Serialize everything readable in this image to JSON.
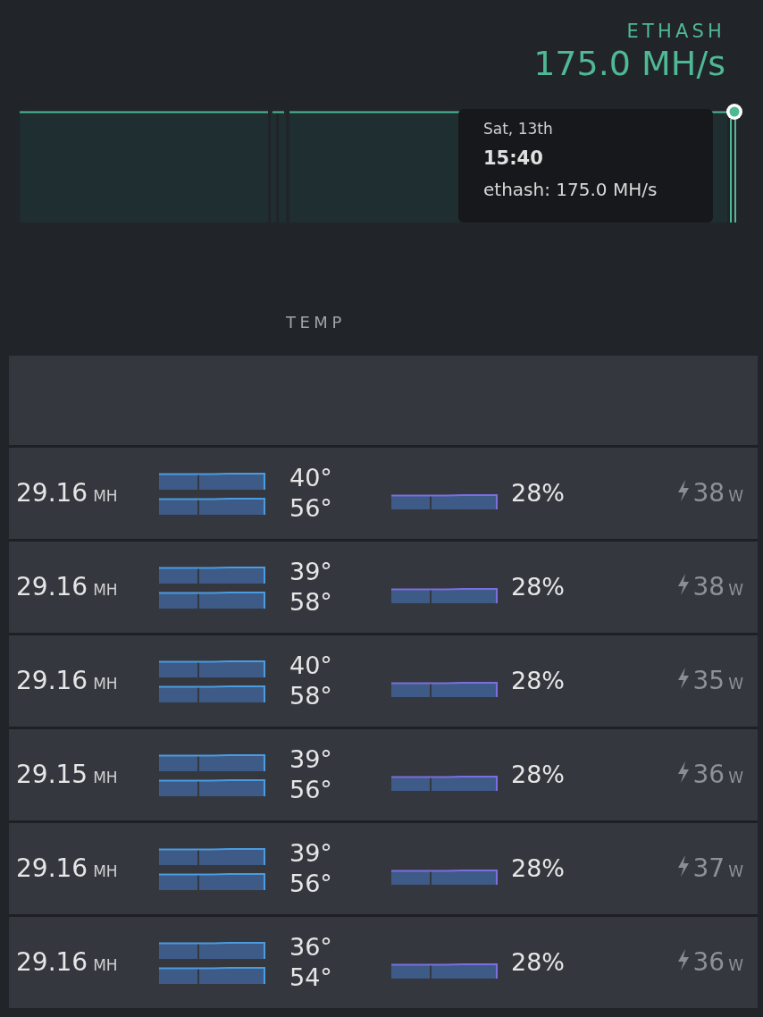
{
  "algorithm": {
    "label": "ETHASH",
    "hashrate": "175.0 MH/s"
  },
  "tooltip": {
    "date": "Sat, 13th",
    "time": "15:40",
    "value": "ethash: 175.0 MH/s"
  },
  "section_label": "TEMP",
  "gpus": [
    {
      "hashrate": "29.16",
      "unit": "MH",
      "temp_core": "40°",
      "temp_mem": "56°",
      "fan": "28%",
      "power": "38",
      "power_unit": "W"
    },
    {
      "hashrate": "29.16",
      "unit": "MH",
      "temp_core": "39°",
      "temp_mem": "58°",
      "fan": "28%",
      "power": "38",
      "power_unit": "W"
    },
    {
      "hashrate": "29.16",
      "unit": "MH",
      "temp_core": "40°",
      "temp_mem": "58°",
      "fan": "28%",
      "power": "35",
      "power_unit": "W"
    },
    {
      "hashrate": "29.15",
      "unit": "MH",
      "temp_core": "39°",
      "temp_mem": "56°",
      "fan": "28%",
      "power": "36",
      "power_unit": "W"
    },
    {
      "hashrate": "29.16",
      "unit": "MH",
      "temp_core": "39°",
      "temp_mem": "56°",
      "fan": "28%",
      "power": "37",
      "power_unit": "W"
    },
    {
      "hashrate": "29.16",
      "unit": "MH",
      "temp_core": "36°",
      "temp_mem": "54°",
      "fan": "28%",
      "power": "36",
      "power_unit": "W"
    }
  ]
}
